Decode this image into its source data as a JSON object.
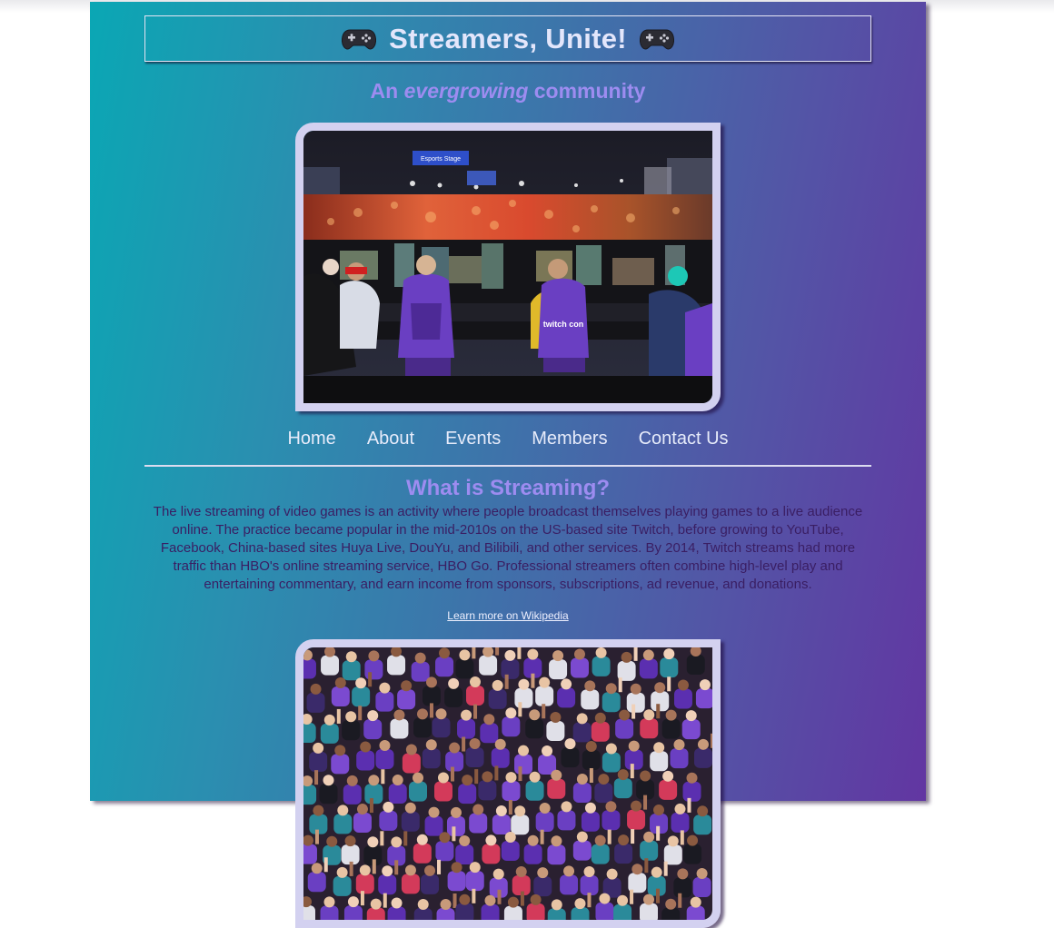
{
  "header": {
    "title": "Streamers, Unite!",
    "left_icon": "gamepad-icon",
    "right_icon": "gamepad-icon"
  },
  "tagline": {
    "prefix": "An",
    "emphasis": "evergrowing",
    "suffix": "community"
  },
  "hero_image": {
    "description_icon": "esports-arena-photo",
    "banner_text": "Esports Stage",
    "chair_brand": "twitch con"
  },
  "nav": {
    "items": [
      {
        "label": "Home"
      },
      {
        "label": "About"
      },
      {
        "label": "Events"
      },
      {
        "label": "Members"
      },
      {
        "label": "Contact Us"
      }
    ]
  },
  "section": {
    "title": "What is Streaming?",
    "body": "The live streaming of video games is an activity where people broadcast themselves playing games to a live audience online. The practice became popular in the mid-2010s on the US-based site Twitch, before growing to YouTube, Facebook, China-based sites Huya Live, DouYu, and Bilibili, and other services. By 2014, Twitch streams had more traffic than HBO's online streaming service, HBO Go. Professional streamers often combine high-level play and entertaining commentary, and earn income from sponsors, subscriptions, ad revenue, and donations.",
    "link_label": "Learn more on Wikipedia"
  },
  "second_image": {
    "description_icon": "crowd-photo"
  },
  "colors": {
    "gradient_start": "#0aa7b4",
    "gradient_end": "#6236a2",
    "accent": "#9d8cf0",
    "frame": "#d3d1f0",
    "body_text": "#3a1e63"
  }
}
